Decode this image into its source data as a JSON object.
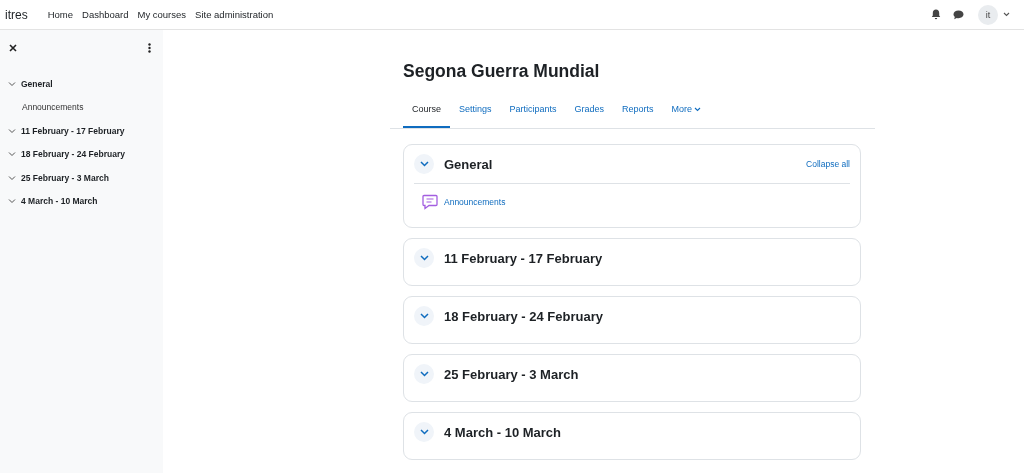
{
  "navbar": {
    "brand": "itres",
    "links": [
      "Home",
      "Dashboard",
      "My courses",
      "Site administration"
    ],
    "avatar": "it"
  },
  "sidebar": {
    "items": [
      {
        "label": "General",
        "expanded": true,
        "children": [
          {
            "label": "Announcements"
          }
        ]
      },
      {
        "label": "11 February - 17 February",
        "expanded": true
      },
      {
        "label": "18 February - 24 February",
        "expanded": true
      },
      {
        "label": "25 February - 3 March",
        "expanded": true
      },
      {
        "label": "4 March - 10 March",
        "expanded": true
      }
    ]
  },
  "course": {
    "title": "Segona Guerra Mundial",
    "tabs": [
      {
        "label": "Course",
        "selected": true
      },
      {
        "label": "Settings",
        "selected": false
      },
      {
        "label": "Participants",
        "selected": false
      },
      {
        "label": "Grades",
        "selected": false
      },
      {
        "label": "Reports",
        "selected": false
      },
      {
        "label": "More",
        "selected": false,
        "kind": "menu"
      }
    ],
    "collapse_all": "Collapse all",
    "sections": [
      {
        "title": "General",
        "expanded": true,
        "activities": [
          {
            "name": "Announcements"
          }
        ]
      },
      {
        "title": "11 February - 17 February",
        "expanded": true
      },
      {
        "title": "18 February - 24 February",
        "expanded": true
      },
      {
        "title": "25 February - 3 March",
        "expanded": true
      },
      {
        "title": "4 March - 10 March",
        "expanded": true
      }
    ]
  }
}
